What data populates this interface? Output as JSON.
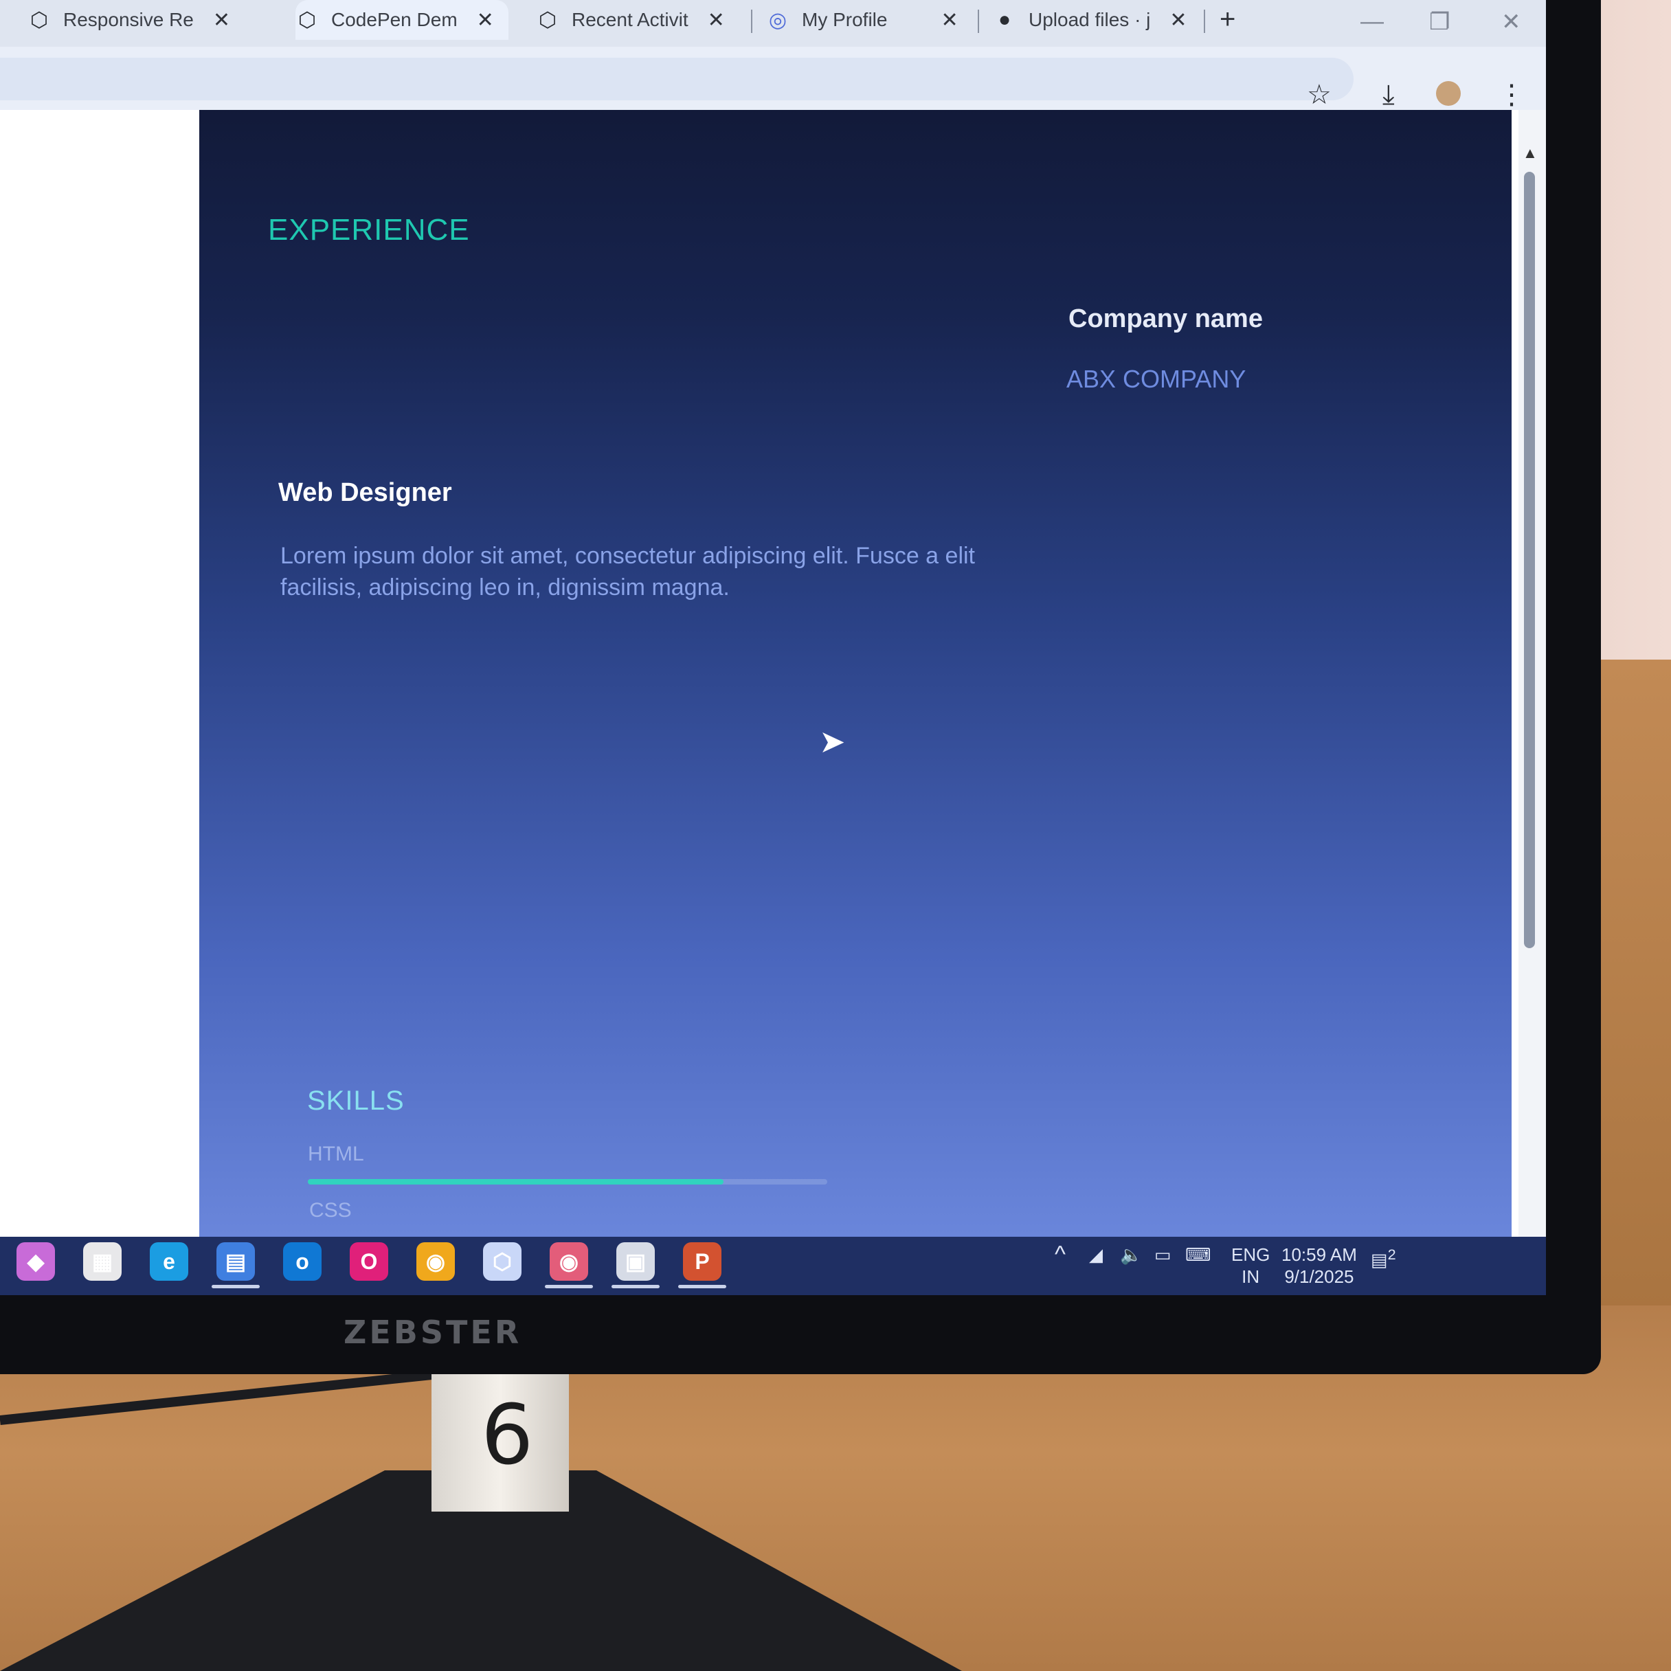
{
  "browser": {
    "tabs": [
      {
        "label": "Responsive Re",
        "icon": "codepen-icon"
      },
      {
        "label": "CodePen Dem",
        "icon": "codepen-icon"
      },
      {
        "label": "Recent Activit",
        "icon": "codepen-icon"
      },
      {
        "label": "My Profile",
        "icon": "profile-icon"
      },
      {
        "label": "Upload files · j",
        "icon": "github-icon"
      }
    ],
    "new_tab_glyph": "+",
    "close_glyph": "✕",
    "bookmark_glyph": "☆",
    "download_glyph": "⤓",
    "menu_glyph": "⋮",
    "minimize_glyph": "—",
    "restore_glyph": "❐",
    "window_close_glyph": "✕"
  },
  "page": {
    "experience_title": "EXPERIENCE",
    "company_label": "Company name",
    "company_value": "ABX COMPANY",
    "job_title": "Web Designer",
    "job_description": "Lorem ipsum dolor sit amet, consectetur adipiscing elit. Fusce a elit facilisis, adipiscing leo in, dignissim magna.",
    "skills_title": "SKILLS",
    "skills": [
      {
        "name": "HTML",
        "level": 0.8
      },
      {
        "name": "CSS"
      }
    ]
  },
  "colors": {
    "accent_teal": "#1fc8b0",
    "content_top": "#121a39",
    "content_bottom": "#6a86db"
  },
  "taskbar": {
    "apps": [
      {
        "name": "copilot-icon",
        "glyph": "◆",
        "color": "#c86bd8"
      },
      {
        "name": "calendar-icon",
        "glyph": "▦",
        "color": "#e8e8ea"
      },
      {
        "name": "edge-icon",
        "glyph": "e",
        "color": "#1b9de2"
      },
      {
        "name": "file-explorer-icon",
        "glyph": "▤",
        "color": "#3f7fe0"
      },
      {
        "name": "outlook-icon",
        "glyph": "o",
        "color": "#1078d4"
      },
      {
        "name": "opera-icon",
        "glyph": "O",
        "color": "#e0207a"
      },
      {
        "name": "chrome-icon",
        "glyph": "◉",
        "color": "#f0a81c"
      },
      {
        "name": "cube-app-icon",
        "glyph": "⬡",
        "color": "#c9d7f8"
      },
      {
        "name": "chrome-profile-icon",
        "glyph": "◉",
        "color": "#e35d7a"
      },
      {
        "name": "terminal-icon",
        "glyph": "▣",
        "color": "#d6dbe6"
      },
      {
        "name": "powerpoint-icon",
        "glyph": "P",
        "color": "#d35230"
      }
    ],
    "tray": {
      "chevron": "^",
      "language": "ENG",
      "region": "IN",
      "time": "10:59 AM",
      "date": "9/1/2025",
      "notification_count": "2"
    }
  },
  "device": {
    "brand": "ZEBSTER",
    "stand_label": "6"
  }
}
